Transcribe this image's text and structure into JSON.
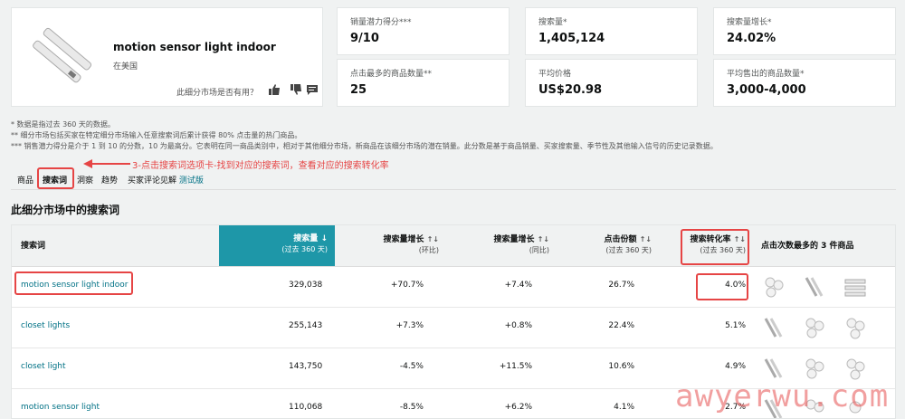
{
  "product": {
    "title": "motion sensor light indoor",
    "subtitle": "在美国",
    "helpful_question": "此细分市场是否有用？"
  },
  "metrics": [
    {
      "label": "销量潜力得分***",
      "value": "9/10"
    },
    {
      "label": "搜索量*",
      "value": "1,405,124"
    },
    {
      "label": "搜索量增长*",
      "value": "24.02%"
    },
    {
      "label": "点击最多的商品数量**",
      "value": "25"
    },
    {
      "label": "平均价格",
      "value": "US$20.98"
    },
    {
      "label": "平均售出的商品数量*",
      "value": "3,000-4,000"
    }
  ],
  "notes": [
    "* 数据是指过去 360 天的数据。",
    "** 细分市场包括买家在特定细分市场输入任意搜索词后累计获得 80% 点击量的热门商品。",
    "*** 销售潜力得分是介于 1 到 10 的分数，10 为最高分。它表明在同一商品类别中，相对于其他细分市场，新商品在该细分市场的潜在销量。此分数是基于商品销量、买家搜索量、季节性及其他输入信号的历史记录数据。"
  ],
  "tabs": [
    "商品",
    "搜索词",
    "洞察",
    "趋势",
    "买家评论见解"
  ],
  "beta_label": "测试版",
  "annotation": "3-点击搜索词选项卡-找到对应的搜索词，查看对应的搜索转化率",
  "section_title": "此细分市场中的搜索词",
  "table": {
    "headers": {
      "keyword": "搜索词",
      "volume": "搜索量",
      "volume_sub": "(过去 360 天)",
      "growth_mom": "搜索量增长",
      "growth_mom_sub": "(环比)",
      "growth_yoy": "搜索量增长",
      "growth_yoy_sub": "(同比)",
      "click_share": "点击份额",
      "click_share_sub": "(过去 360 天)",
      "conversion": "搜索转化率",
      "conversion_sub": "(过去 360 天)",
      "top_products": "点击次数最多的 3 件商品"
    },
    "rows": [
      {
        "keyword": "motion sensor light indoor",
        "volume": "329,038",
        "mom": "+70.7%",
        "yoy": "+7.4%",
        "click": "26.7%",
        "conv": "4.0%"
      },
      {
        "keyword": "closet lights",
        "volume": "255,143",
        "mom": "+7.3%",
        "yoy": "+0.8%",
        "click": "22.4%",
        "conv": "5.1%"
      },
      {
        "keyword": "closet light",
        "volume": "143,750",
        "mom": "-4.5%",
        "yoy": "+11.5%",
        "click": "10.6%",
        "conv": "4.9%"
      },
      {
        "keyword": "motion sensor light",
        "volume": "110,068",
        "mom": "-8.5%",
        "yoy": "+6.2%",
        "click": "4.1%",
        "conv": "2.7%"
      }
    ]
  },
  "watermark": "awyerwu.com",
  "colors": {
    "selected_header": "#1e97a8",
    "link": "#007185",
    "annotation": "#e64545"
  }
}
